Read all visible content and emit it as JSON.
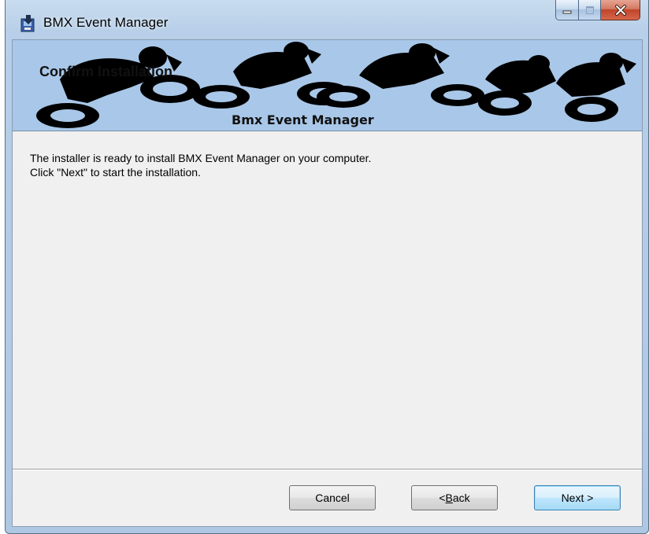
{
  "window": {
    "title": "BMX Event Manager"
  },
  "banner": {
    "heading": "Confirm Installation",
    "caption": "Bmx Event Manager"
  },
  "body": {
    "line1": "The installer is ready to install BMX Event Manager on your computer.",
    "line2": "Click \"Next\" to start the installation."
  },
  "buttons": {
    "cancel": "Cancel",
    "back_prefix": "< ",
    "back_accel": "B",
    "back_rest": "ack",
    "next": "Next >"
  },
  "colors": {
    "banner_bg": "#a9c7e8",
    "client_bg": "#f0f0f0",
    "close_red": "#c0442a"
  },
  "icons": [
    "app-installer-icon",
    "minimize-icon",
    "maximize-icon",
    "close-icon",
    "bmx-riders-graphic"
  ]
}
